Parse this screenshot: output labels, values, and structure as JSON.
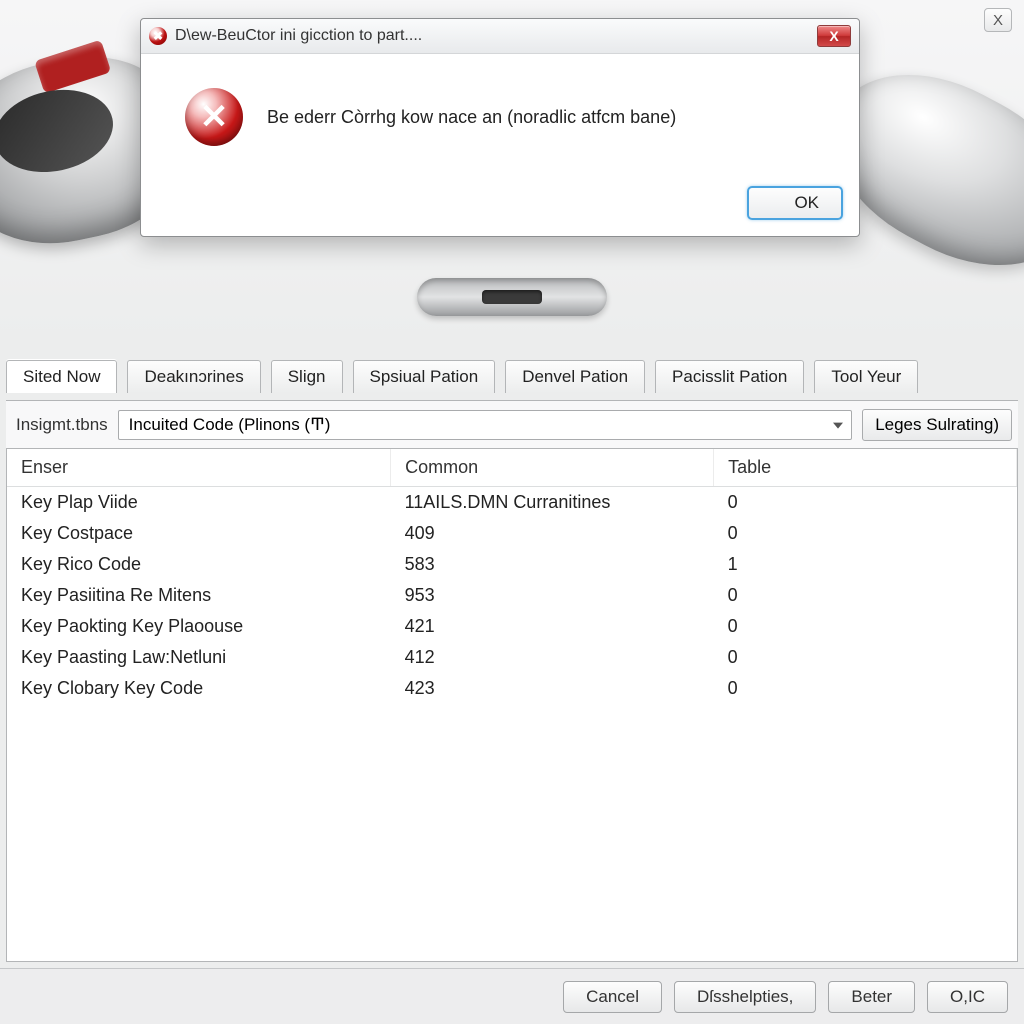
{
  "outer_close": "X",
  "dialog": {
    "title": "D\\ew-BeuCtor ini gicction to part....",
    "message": "Be ederr Còrrhg kow nace an (noradlic atfcm bane)",
    "ok_label": "OK",
    "close_label": "X"
  },
  "tabs": [
    {
      "label": "Sited Now",
      "active": true
    },
    {
      "label": "Deakınɔrines",
      "active": false
    },
    {
      "label": "Slign",
      "active": false
    },
    {
      "label": "Spsiual Pation",
      "active": false
    },
    {
      "label": "Denvel Pation",
      "active": false
    },
    {
      "label": "Pacisslit Pation",
      "active": false
    },
    {
      "label": "Tool Yeur",
      "active": false
    }
  ],
  "dropdown": {
    "label": "Insigmt.tbns",
    "value": "Incuited Code (Plinons (Ͳ)",
    "side_button": "Leges Sulrating)"
  },
  "table": {
    "headers": [
      "Enser",
      "Common",
      "Table"
    ],
    "rows": [
      {
        "c0": "Key Plap Viide",
        "c1": "11AILS.DMN Curranitines",
        "c2": "0"
      },
      {
        "c0": "Key Costpace",
        "c1": "409",
        "c2": "0"
      },
      {
        "c0": "Key Rico Code",
        "c1": "583",
        "c2": "1"
      },
      {
        "c0": "Key Pasiitina Re Mitens",
        "c1": "953",
        "c2": "0"
      },
      {
        "c0": "Key Paokting Key Plaoouse",
        "c1": "421",
        "c2": "0"
      },
      {
        "c0": "Key Paasting Law:Netluni",
        "c1": "412",
        "c2": "0"
      },
      {
        "c0": "Key Clobary Key Code",
        "c1": "423",
        "c2": "0"
      }
    ]
  },
  "footer": {
    "cancel": "Cancel",
    "disshelpties": "Dſsshelpties,",
    "beter": "Beter",
    "oic": "O,IC"
  }
}
